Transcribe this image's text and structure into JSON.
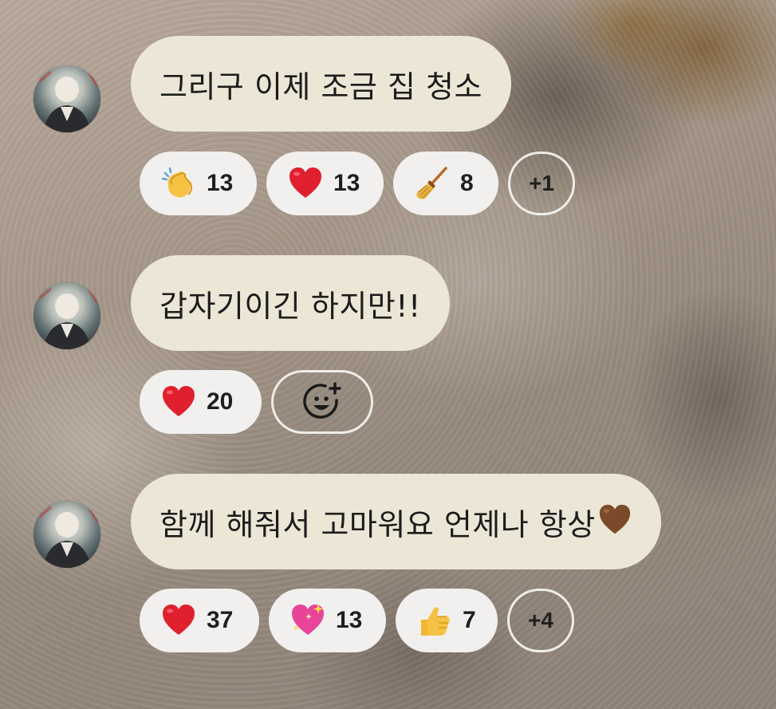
{
  "messages": [
    {
      "text": "그리구 이제 조금 집 청소",
      "reactions": [
        {
          "icon": "clapping-hands-icon",
          "count": "13"
        },
        {
          "icon": "red-heart-icon",
          "count": "13"
        },
        {
          "icon": "broom-icon",
          "count": "8"
        }
      ],
      "more": "+1"
    },
    {
      "text": "갑자기이긴 하지만!!",
      "reactions": [
        {
          "icon": "red-heart-icon",
          "count": "20"
        }
      ],
      "add_reaction_icon": "add-reaction-smiley-icon"
    },
    {
      "text": "함께 해줘서 고마워요 언제나 항상",
      "trailing_emoji": "brown-heart-icon",
      "reactions": [
        {
          "icon": "red-heart-icon",
          "count": "37"
        },
        {
          "icon": "sparkling-heart-icon",
          "count": "13"
        },
        {
          "icon": "thumbs-up-icon",
          "count": "7"
        }
      ],
      "more": "+4"
    }
  ],
  "colors": {
    "bubble": "#ece6d6",
    "chip": "#f2f0ee",
    "text": "#1c1c1c",
    "heart": "#e0202e",
    "brown_heart": "#7a4a2a"
  }
}
